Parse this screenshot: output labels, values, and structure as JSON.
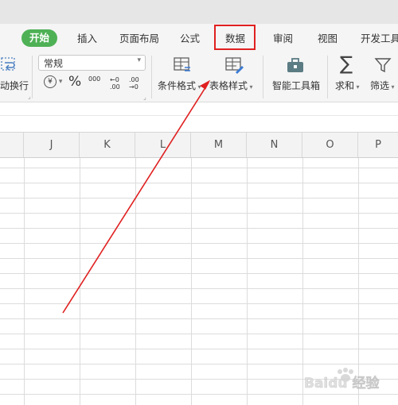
{
  "tabs": {
    "home": "开始",
    "insert": "插入",
    "page_layout": "页面布局",
    "formulas": "公式",
    "data": "数据",
    "review": "审阅",
    "view": "视图",
    "developer": "开发工具"
  },
  "ribbon": {
    "wrap_text": "动换行",
    "number_format_value": "常规",
    "conditional_format": "条件格式",
    "table_style": "表格样式",
    "smart_toolbox": "智能工具箱",
    "sum": "求和",
    "filter": "筛选",
    "currency_symbol": "¥",
    "percent_symbol": "%",
    "thousands_symbol": "000",
    "inc_decimal": "←0 .00",
    "dec_decimal": ".00 →0"
  },
  "columns": [
    "J",
    "K",
    "L",
    "M",
    "N",
    "O",
    "P"
  ],
  "watermark": "Baidu 经验",
  "colors": {
    "accent_green": "#4fb156",
    "highlight_red": "#e02020",
    "arrow_red": "#e02020",
    "smart_tool_icon": "#5b7c83"
  }
}
